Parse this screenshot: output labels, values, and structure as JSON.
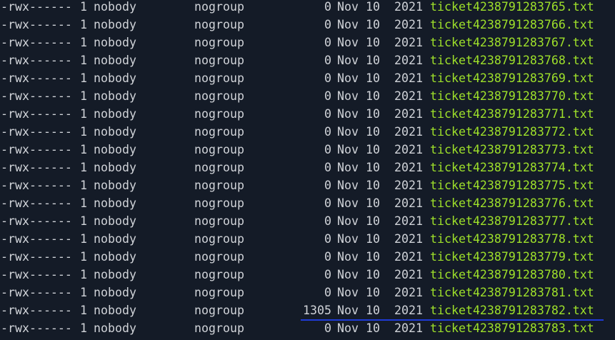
{
  "terminal": {
    "rows": [
      {
        "perms": "-rwx------",
        "links": "1",
        "owner": "nobody",
        "group": "nogroup",
        "size": "0",
        "month": "Nov",
        "day": "10",
        "year": "2021",
        "name": "ticket4238791283765.txt"
      },
      {
        "perms": "-rwx------",
        "links": "1",
        "owner": "nobody",
        "group": "nogroup",
        "size": "0",
        "month": "Nov",
        "day": "10",
        "year": "2021",
        "name": "ticket4238791283766.txt"
      },
      {
        "perms": "-rwx------",
        "links": "1",
        "owner": "nobody",
        "group": "nogroup",
        "size": "0",
        "month": "Nov",
        "day": "10",
        "year": "2021",
        "name": "ticket4238791283767.txt"
      },
      {
        "perms": "-rwx------",
        "links": "1",
        "owner": "nobody",
        "group": "nogroup",
        "size": "0",
        "month": "Nov",
        "day": "10",
        "year": "2021",
        "name": "ticket4238791283768.txt"
      },
      {
        "perms": "-rwx------",
        "links": "1",
        "owner": "nobody",
        "group": "nogroup",
        "size": "0",
        "month": "Nov",
        "day": "10",
        "year": "2021",
        "name": "ticket4238791283769.txt"
      },
      {
        "perms": "-rwx------",
        "links": "1",
        "owner": "nobody",
        "group": "nogroup",
        "size": "0",
        "month": "Nov",
        "day": "10",
        "year": "2021",
        "name": "ticket4238791283770.txt"
      },
      {
        "perms": "-rwx------",
        "links": "1",
        "owner": "nobody",
        "group": "nogroup",
        "size": "0",
        "month": "Nov",
        "day": "10",
        "year": "2021",
        "name": "ticket4238791283771.txt"
      },
      {
        "perms": "-rwx------",
        "links": "1",
        "owner": "nobody",
        "group": "nogroup",
        "size": "0",
        "month": "Nov",
        "day": "10",
        "year": "2021",
        "name": "ticket4238791283772.txt"
      },
      {
        "perms": "-rwx------",
        "links": "1",
        "owner": "nobody",
        "group": "nogroup",
        "size": "0",
        "month": "Nov",
        "day": "10",
        "year": "2021",
        "name": "ticket4238791283773.txt"
      },
      {
        "perms": "-rwx------",
        "links": "1",
        "owner": "nobody",
        "group": "nogroup",
        "size": "0",
        "month": "Nov",
        "day": "10",
        "year": "2021",
        "name": "ticket4238791283774.txt"
      },
      {
        "perms": "-rwx------",
        "links": "1",
        "owner": "nobody",
        "group": "nogroup",
        "size": "0",
        "month": "Nov",
        "day": "10",
        "year": "2021",
        "name": "ticket4238791283775.txt"
      },
      {
        "perms": "-rwx------",
        "links": "1",
        "owner": "nobody",
        "group": "nogroup",
        "size": "0",
        "month": "Nov",
        "day": "10",
        "year": "2021",
        "name": "ticket4238791283776.txt"
      },
      {
        "perms": "-rwx------",
        "links": "1",
        "owner": "nobody",
        "group": "nogroup",
        "size": "0",
        "month": "Nov",
        "day": "10",
        "year": "2021",
        "name": "ticket4238791283777.txt"
      },
      {
        "perms": "-rwx------",
        "links": "1",
        "owner": "nobody",
        "group": "nogroup",
        "size": "0",
        "month": "Nov",
        "day": "10",
        "year": "2021",
        "name": "ticket4238791283778.txt"
      },
      {
        "perms": "-rwx------",
        "links": "1",
        "owner": "nobody",
        "group": "nogroup",
        "size": "0",
        "month": "Nov",
        "day": "10",
        "year": "2021",
        "name": "ticket4238791283779.txt"
      },
      {
        "perms": "-rwx------",
        "links": "1",
        "owner": "nobody",
        "group": "nogroup",
        "size": "0",
        "month": "Nov",
        "day": "10",
        "year": "2021",
        "name": "ticket4238791283780.txt"
      },
      {
        "perms": "-rwx------",
        "links": "1",
        "owner": "nobody",
        "group": "nogroup",
        "size": "0",
        "month": "Nov",
        "day": "10",
        "year": "2021",
        "name": "ticket4238791283781.txt"
      },
      {
        "perms": "-rwx------",
        "links": "1",
        "owner": "nobody",
        "group": "nogroup",
        "size": "1305",
        "month": "Nov",
        "day": "10",
        "year": "2021",
        "name": "ticket4238791283782.txt"
      },
      {
        "perms": "-rwx------",
        "links": "1",
        "owner": "nobody",
        "group": "nogroup",
        "size": "0",
        "month": "Nov",
        "day": "10",
        "year": "2021",
        "name": "ticket4238791283783.txt"
      }
    ]
  }
}
